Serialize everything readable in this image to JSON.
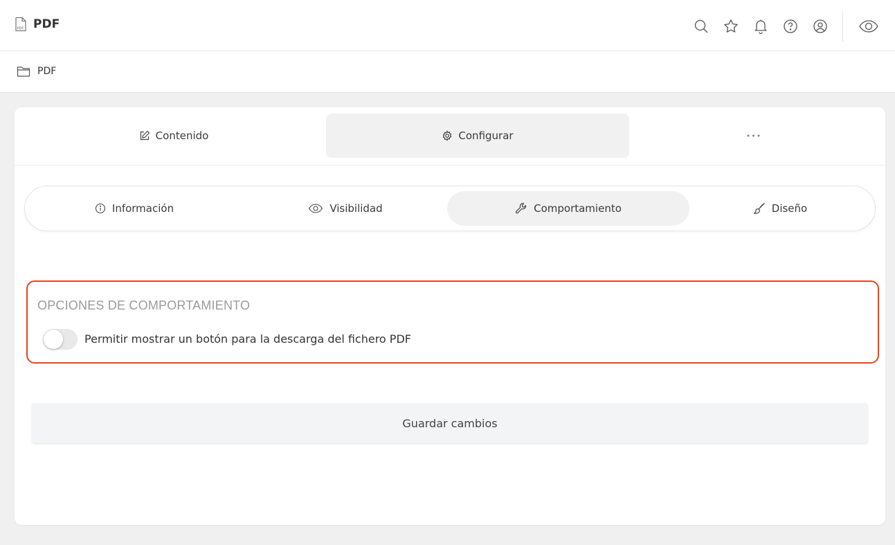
{
  "header": {
    "title": "PDF",
    "file_icon": "file-pdf-icon",
    "actions": [
      {
        "name": "search-icon"
      },
      {
        "name": "star-icon"
      },
      {
        "name": "bell-icon"
      },
      {
        "name": "help-icon"
      },
      {
        "name": "user-icon"
      },
      {
        "name": "eye-icon"
      }
    ]
  },
  "breadcrumb": {
    "icon": "folder-icon",
    "label": "PDF"
  },
  "main_tabs": [
    {
      "label": "Contenido",
      "icon": "edit-icon",
      "active": false
    },
    {
      "label": "Configurar",
      "icon": "gear-icon",
      "active": true
    },
    {
      "label": "•••",
      "icon": "more-icon",
      "active": false
    }
  ],
  "sub_tabs": [
    {
      "label": "Información",
      "icon": "info-icon",
      "active": false
    },
    {
      "label": "Visibilidad",
      "icon": "eye-icon",
      "active": false
    },
    {
      "label": "Comportamiento",
      "icon": "wrench-icon",
      "active": true
    },
    {
      "label": "Diseño",
      "icon": "brush-icon",
      "active": false
    }
  ],
  "behavior": {
    "title": "OPCIONES DE COMPORTAMIENTO",
    "toggle_label": "Permitir mostrar un botón para la descarga del fichero PDF",
    "toggle_on": false,
    "highlight_color": "#e5451d"
  },
  "save_label": "Guardar cambios"
}
